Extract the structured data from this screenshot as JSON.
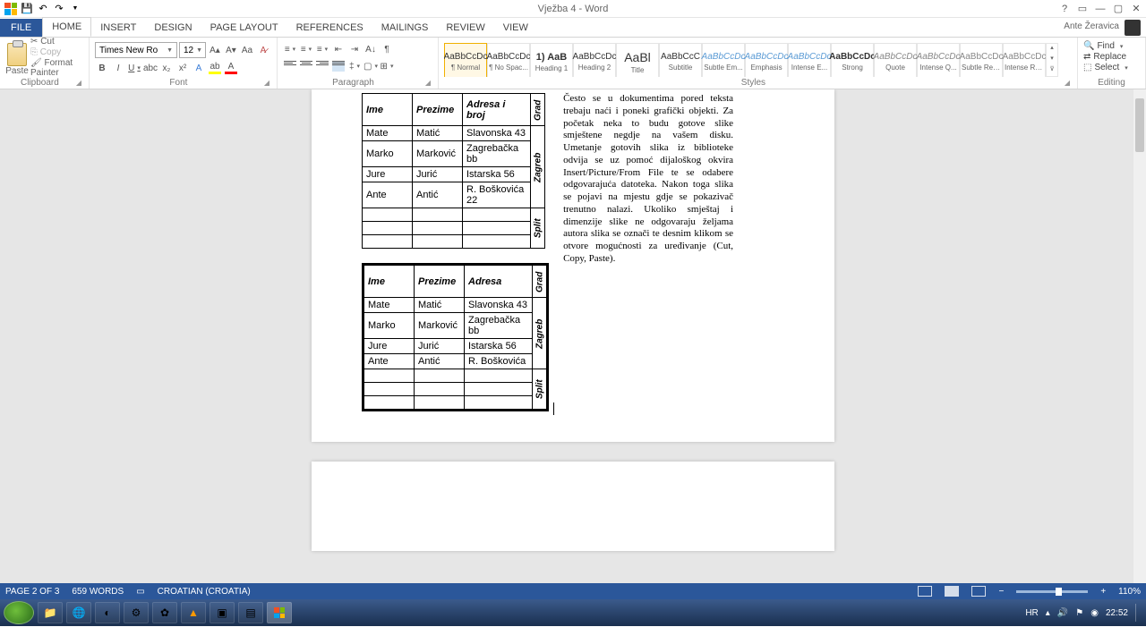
{
  "app": {
    "title": "Vježba 4 - Word",
    "user": "Ante Žeravica"
  },
  "qat": [
    "word",
    "save",
    "undo",
    "redo"
  ],
  "tabs": {
    "file": "FILE",
    "items": [
      "HOME",
      "INSERT",
      "DESIGN",
      "PAGE LAYOUT",
      "REFERENCES",
      "MAILINGS",
      "REVIEW",
      "VIEW"
    ],
    "active": 0
  },
  "clipboard": {
    "paste": "Paste",
    "cut": "Cut",
    "copy": "Copy",
    "fp": "Format Painter",
    "label": "Clipboard"
  },
  "font": {
    "name": "Times New Ro",
    "size": "12",
    "label": "Font"
  },
  "paragraph": {
    "label": "Paragraph"
  },
  "styles": {
    "label": "Styles",
    "items": [
      {
        "prev": "AaBbCcDc",
        "name": "¶ Normal"
      },
      {
        "prev": "AaBbCcDc",
        "name": "¶ No Spac..."
      },
      {
        "prev": "1) AaB",
        "name": "Heading 1"
      },
      {
        "prev": "AaBbCcDc",
        "name": "Heading 2"
      },
      {
        "prev": "AaBl",
        "name": "Title"
      },
      {
        "prev": "AaBbCcC",
        "name": "Subtitle"
      },
      {
        "prev": "AaBbCcDc",
        "name": "Subtle Em..."
      },
      {
        "prev": "AaBbCcDc",
        "name": "Emphasis"
      },
      {
        "prev": "AaBbCcDc",
        "name": "Intense E..."
      },
      {
        "prev": "AaBbCcDc",
        "name": "Strong"
      },
      {
        "prev": "AaBbCcDc",
        "name": "Quote"
      },
      {
        "prev": "AaBbCcDc",
        "name": "Intense Q..."
      },
      {
        "prev": "AaBbCcDc",
        "name": "Subtle Ref..."
      },
      {
        "prev": "AaBbCcDc",
        "name": "Intense Re..."
      }
    ]
  },
  "editing": {
    "find": "Find",
    "replace": "Replace",
    "select": "Select",
    "label": "Editing"
  },
  "doc": {
    "table1": {
      "headers": [
        "Ime",
        "Prezime",
        "Adresa i broj",
        "Grad"
      ],
      "rows": [
        [
          "Mate",
          "Matić",
          "Slavonska 43"
        ],
        [
          "Marko",
          "Marković",
          "Zagrebačka bb"
        ],
        [
          "Jure",
          "Jurić",
          "Istarska 56"
        ],
        [
          "Ante",
          "Antić",
          "R. Boškovića 22"
        ],
        [
          "",
          "",
          ""
        ],
        [
          "",
          "",
          ""
        ],
        [
          "",
          "",
          ""
        ]
      ],
      "vlabels": [
        "Zagreb",
        "Split"
      ]
    },
    "table2": {
      "headers": [
        "Ime",
        "Prezime",
        "Adresa",
        "Grad"
      ],
      "rows": [
        [
          "Mate",
          "Matić",
          "Slavonska 43"
        ],
        [
          "Marko",
          "Marković",
          "Zagrebačka bb"
        ],
        [
          "Jure",
          "Jurić",
          "Istarska 56"
        ],
        [
          "Ante",
          "Antić",
          "R. Boškovića"
        ],
        [
          "",
          "",
          ""
        ],
        [
          "",
          "",
          ""
        ],
        [
          "",
          "",
          ""
        ]
      ],
      "vlabels": [
        "Zagreb",
        "Split"
      ]
    },
    "paragraph": "Često se u dokumentima pored teksta trebaju naći i poneki grafički objekti. Za početak neka to budu gotove slike smještene negdje na vašem disku. Umetanje gotovih slika iz biblioteke odvija se uz pomoć dijaloškog okvira Insert/Picture/From File te se odabere odgovarajuća datoteka. Nakon toga slika se pojavi na mjestu gdje se pokazivač trenutno nalazi. Ukoliko smještaj i dimenzije slike ne odgovaraju željama autora slika se označi te desnim klikom se otvore mogućnosti za uređivanje (Cut, Copy, Paste)."
  },
  "status": {
    "page": "PAGE 2 OF 3",
    "words": "659 WORDS",
    "lang": "CROATIAN (CROATIA)",
    "zoom": "110%"
  },
  "taskbar": {
    "lang": "HR",
    "time": "22:52"
  }
}
